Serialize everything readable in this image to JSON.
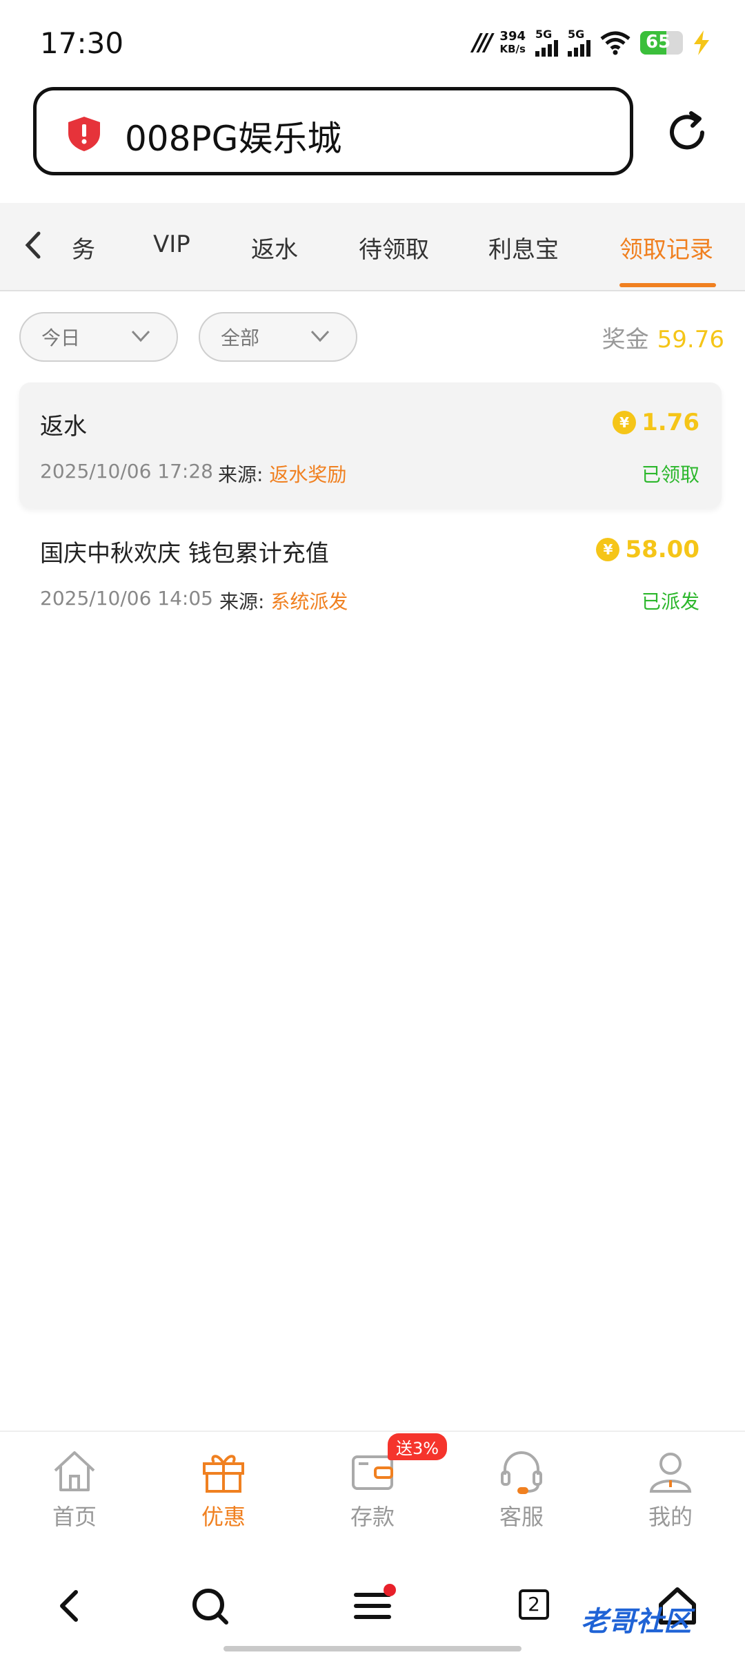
{
  "status_bar": {
    "time": "17:30",
    "net_speed_value": "394",
    "net_speed_unit": "KB/s",
    "sim1": "5G",
    "sim2": "5G",
    "battery": "65"
  },
  "url_bar": {
    "title": "008PG娱乐城"
  },
  "tabs": [
    {
      "label": "务"
    },
    {
      "label": "VIP"
    },
    {
      "label": "返水"
    },
    {
      "label": "待领取"
    },
    {
      "label": "利息宝"
    },
    {
      "label": "领取记录"
    }
  ],
  "filters": {
    "date": "今日",
    "type": "全部"
  },
  "bonus": {
    "label": "奖金",
    "value": "59.76"
  },
  "records": [
    {
      "name": "返水",
      "amount": "1.76",
      "date": "2025/10/06 17:28",
      "source_label": "来源:",
      "source": "返水奖励",
      "status": "已领取"
    },
    {
      "name": "国庆中秋欢庆 钱包累计充值",
      "amount": "58.00",
      "date": "2025/10/06 14:05",
      "source_label": "来源:",
      "source": "系统派发",
      "status": "已派发"
    }
  ],
  "coin_symbol": "¥",
  "app_nav": {
    "home": "首页",
    "promo": "优惠",
    "deposit": "存款",
    "deposit_badge": "送3%",
    "service": "客服",
    "mine": "我的"
  },
  "browser_nav": {
    "tab_count": "2"
  },
  "watermark": "老哥社区",
  "colors": {
    "accent": "#f08020",
    "gold": "#f5c518",
    "success": "#2cb72c"
  }
}
